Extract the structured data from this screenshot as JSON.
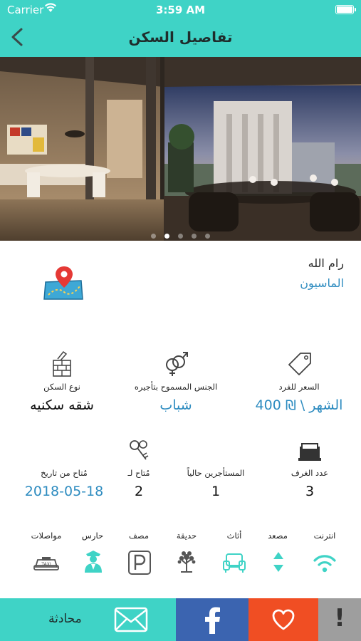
{
  "status_bar": {
    "carrier": "Carrier",
    "time": "3:59 AM"
  },
  "header": {
    "title": "تفاصيل السكن"
  },
  "gallery": {
    "page_count": 5,
    "active_index": 1
  },
  "location": {
    "city": "رام الله",
    "area": "الماسيون"
  },
  "details_row1": {
    "price": {
      "label": "السعر للفرد",
      "value": "400 ₪ \\ الشهر"
    },
    "gender": {
      "label": "الجنس المسموح بتأجيره",
      "value": "شباب"
    },
    "type": {
      "label": "نوع السكن",
      "value": "شقه سكنيه"
    }
  },
  "details_row2": {
    "rooms": {
      "label": "عدد الغرف",
      "value": "3"
    },
    "tenants": {
      "label": "المستأجرين حالياً",
      "value": "1"
    },
    "available_for": {
      "label": "مُتاح لـ",
      "value": "2"
    },
    "available_from": {
      "label": "مُتاح من تاريخ",
      "value": "2018-05-18"
    }
  },
  "amenities": [
    {
      "label": "انترنت",
      "icon": "wifi-icon"
    },
    {
      "label": "مصعد",
      "icon": "elevator-icon"
    },
    {
      "label": "أثاث",
      "icon": "furniture-icon"
    },
    {
      "label": "حديقة",
      "icon": "garden-icon"
    },
    {
      "label": "مصف",
      "icon": "parking-icon"
    },
    {
      "label": "حارس",
      "icon": "guard-icon"
    },
    {
      "label": "مواصلات",
      "icon": "taxi-icon"
    }
  ],
  "bottom_bar": {
    "chat_label": "محادثة",
    "report_label": "!"
  },
  "colors": {
    "teal": "#3fd3c6",
    "blue": "#2e8cc0",
    "facebook": "#3b64b0",
    "favorite": "#f04e23",
    "report": "#9e9e9e"
  }
}
